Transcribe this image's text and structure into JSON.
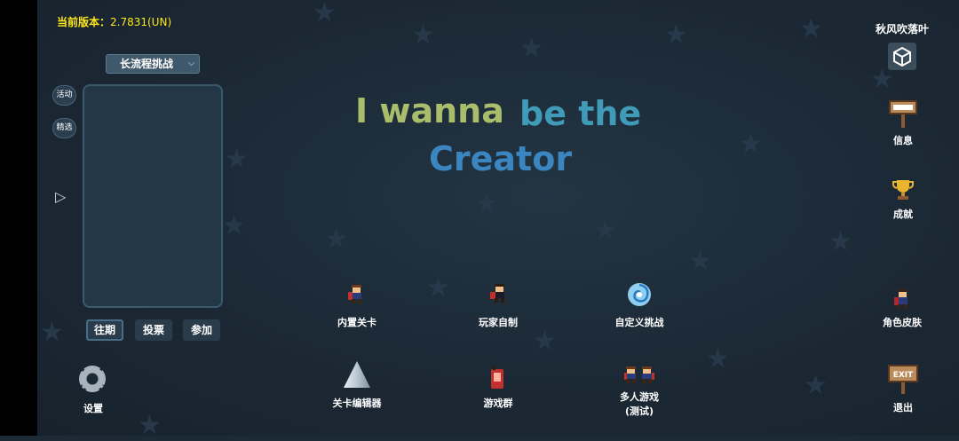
{
  "version": {
    "label": "当前版本：",
    "value": "2.7831(UN)"
  },
  "user": {
    "name": "秋风吹落叶"
  },
  "title": {
    "line1a": "I wanna",
    "line1b": "be the",
    "line2": "Creator"
  },
  "left_panel": {
    "dropdown_value": "长流程挑战",
    "side_tabs": [
      "活动",
      "精选"
    ],
    "bottom_tabs": [
      "往期",
      "投票",
      "参加"
    ]
  },
  "menu": {
    "builtin_levels": "内置关卡",
    "player_made": "玩家自制",
    "custom_challenge": "自定义挑战",
    "level_editor": "关卡编辑器",
    "game_group": "游戏群",
    "multiplayer_line1": "多人游戏",
    "multiplayer_line2": "(测试)"
  },
  "right_menu": {
    "info": "信息",
    "achievements": "成就",
    "skins": "角色皮肤",
    "exit": "退出"
  },
  "settings_label": "设置",
  "icons": [
    "unity-icon",
    "sign-icon",
    "trophy-icon",
    "vortex-icon",
    "spike-icon",
    "phone-icon",
    "exit-sign-icon",
    "gear-icon"
  ]
}
